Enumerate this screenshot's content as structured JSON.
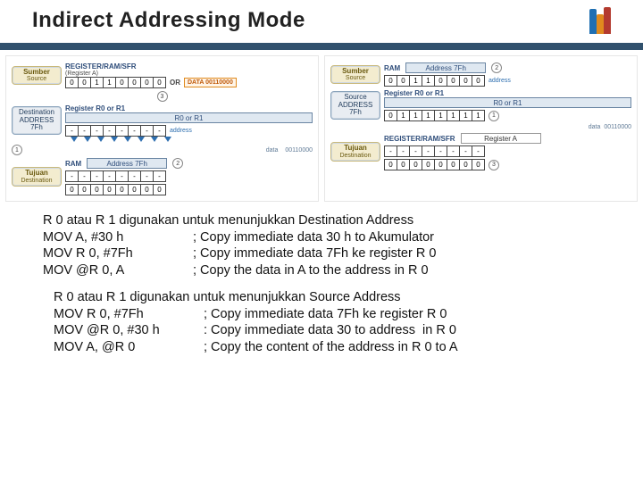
{
  "title": "Indirect Addressing Mode",
  "labels": {
    "sumber": "Sumber",
    "source": "Source",
    "tujuan": "Tujuan",
    "destination": "Destination",
    "dest_addr_7f": "Destination\\nADDRESS\\n7Fh",
    "src_addr_7f": "Source\\nADDRESS\\n7Fh",
    "register_sfr": "REGISTER/RAM/SFR",
    "register_a": "(Register A)",
    "register_a_plain": "Register A",
    "register_r0r1": "Register R0 or R1",
    "r0_or_r1": "R0 or R1",
    "ram": "RAM",
    "address_7fh": "Address 7Fh",
    "data_00110000": "DATA\\n00110000",
    "or": "OR",
    "address": "address",
    "data_word": "data",
    "data_hex_00110000": "00110000"
  },
  "bits": {
    "A30h": [
      "0",
      "0",
      "1",
      "1",
      "0",
      "0",
      "0",
      "0"
    ],
    "addr7F": [
      "0",
      "1",
      "1",
      "1",
      "1",
      "1",
      "1",
      "1"
    ],
    "dashes": [
      "-",
      "-",
      "-",
      "-",
      "-",
      "-",
      "-",
      "-"
    ],
    "zeros": [
      "0",
      "0",
      "0",
      "0",
      "0",
      "0",
      "0",
      "0"
    ],
    "ram_addr": [
      "0",
      "0",
      "1",
      "1",
      "0",
      "0",
      "0",
      "0"
    ]
  },
  "circles": {
    "c1": "1",
    "c2": "2",
    "c3": "3"
  },
  "para1": {
    "heading": "R 0 atau R 1 digunakan untuk menunjukkan Destination Address",
    "lines": [
      {
        "mnemonic": "MOV A, #30 h",
        "comment": "; Copy immediate data 30 h to Akumulator"
      },
      {
        "mnemonic": "MOV R 0, #7Fh",
        "comment": "; Copy immediate data 7Fh ke register R 0"
      },
      {
        "mnemonic": "MOV @R 0, A",
        "comment": "; Copy the data in A to the address in R 0"
      }
    ]
  },
  "para2": {
    "heading": "R 0 atau R 1 digunakan untuk menunjukkan Source Address",
    "lines": [
      {
        "mnemonic": "MOV R 0, #7Fh",
        "comment": "; Copy immediate data 7Fh ke register R 0"
      },
      {
        "mnemonic": "MOV @R 0, #30 h",
        "comment": ": Copy immediate data 30 to address  in R 0"
      },
      {
        "mnemonic": "MOV A, @R 0",
        "comment": "; Copy the content of the address in R 0 to A"
      }
    ]
  }
}
